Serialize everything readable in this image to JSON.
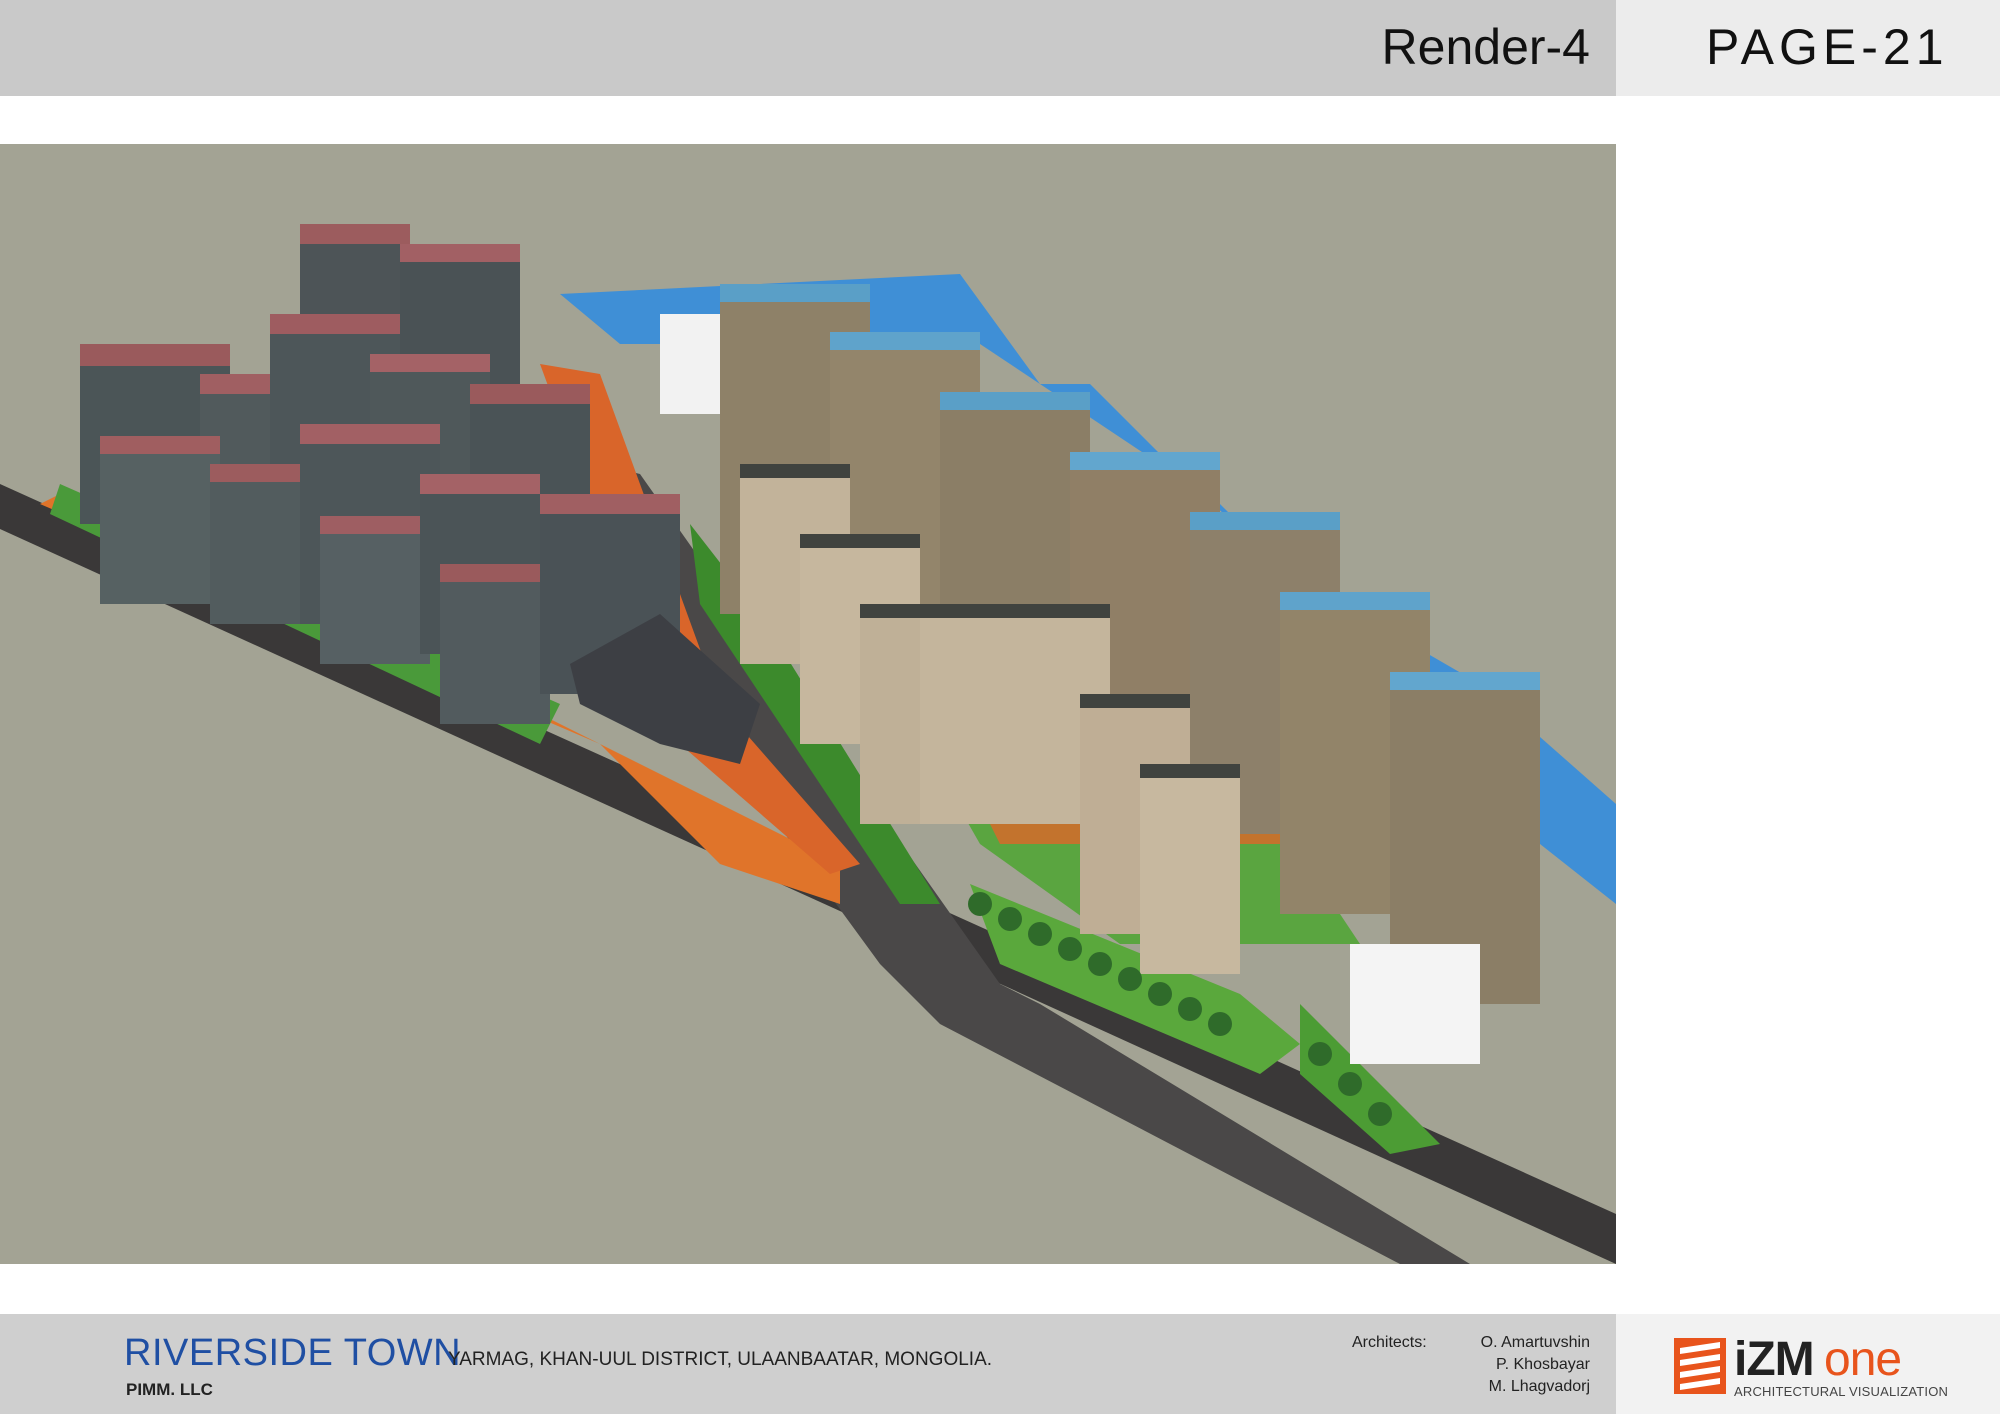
{
  "header": {
    "render_title": "Render-4",
    "page_number": "PAGE-21"
  },
  "image": {
    "description_icon": "aerial-render-image"
  },
  "footer": {
    "project_name": "RIVERSIDE TOWN",
    "location": "YARMAG, KHAN-UUL DISTRICT, ULAANBAATAR, MONGOLIA.",
    "company": "PIMM. LLC",
    "architects_label": "Architects:",
    "architects": [
      "O. Amartuvshin",
      "P. Khosbayar",
      "M. Lhagvadorj"
    ]
  },
  "logo": {
    "part1": "iZM",
    "part2": "one",
    "subtitle": "ARCHITECTURAL VISUALIZATION"
  },
  "colors": {
    "header_bg": "#c9c9c9",
    "project_blue": "#1f4fa3",
    "logo_orange": "#e8541c",
    "ground": "#a3a394"
  }
}
